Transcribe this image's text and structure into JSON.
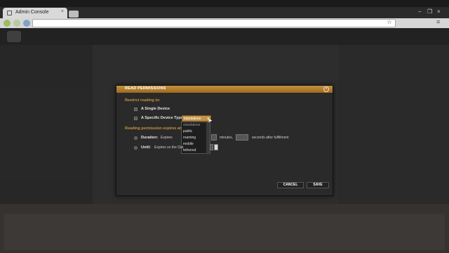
{
  "browser": {
    "tab_title": "Admin Console",
    "tab_close": "×",
    "window_controls": [
      "–",
      "❐",
      "×"
    ],
    "star_glyph": "☆",
    "wrench_glyph": "≡"
  },
  "dialog": {
    "title": "READ PERMISSIONS",
    "close_glyph": "×",
    "restrict_label": "Restrict reading to:",
    "options": [
      {
        "label": "A Single Device"
      },
      {
        "label": "A Specific Device Type"
      }
    ],
    "device_type_select": {
      "value": "standalone",
      "options": [
        "standalone",
        "public",
        "roaming",
        "mobile",
        "tethered"
      ]
    },
    "expires_label": "Reading permission expires at:",
    "duration": {
      "label": "Duration:",
      "prefix": "Expires",
      "minutes_label": "minutes,",
      "seconds_label": "seconds after fulfillment"
    },
    "until": {
      "label": "Until:",
      "prefix": "Expires on the Dat"
    },
    "cancel_label": "CANCEL",
    "save_label": "SAVE"
  }
}
